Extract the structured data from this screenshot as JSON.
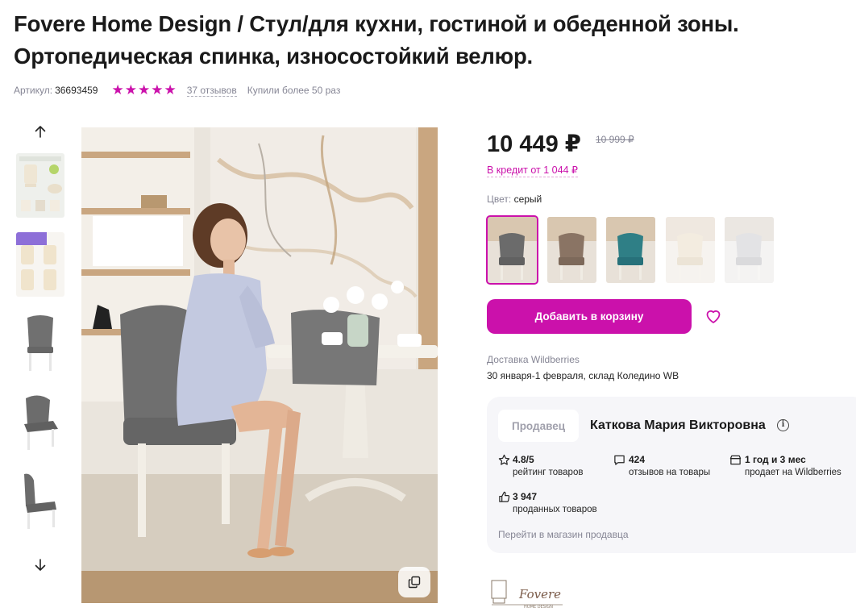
{
  "product": {
    "title": "Fovere Home Design / Стул/для кухни, гостиной и обеденной зоны. Ортопедическая спинка, износостойкий велюр.",
    "article_label": "Артикул:",
    "article_value": "36693459",
    "rating_stars": 5,
    "reviews_link": "37 отзывов",
    "bought": "Купили более 50 раз"
  },
  "gallery": {
    "up_icon": "arrow-up-icon",
    "down_icon": "arrow-down-icon",
    "zoom_icon": "copy-icon"
  },
  "price": {
    "current": "10 449 ₽",
    "old": "10 999 ₽",
    "credit": "В кредит от 1 044 ₽"
  },
  "color": {
    "label": "Цвет:",
    "value": "серый"
  },
  "actions": {
    "add_to_cart": "Добавить в корзину",
    "favorite_icon": "heart-icon"
  },
  "delivery": {
    "label": "Доставка Wildberries",
    "value": "30 января-1 февраля, склад Коледино WB"
  },
  "seller": {
    "tag": "Продавец",
    "name": "Каткова Мария Викторовна",
    "stats": [
      {
        "icon": "star-outline-icon",
        "value": "4.8/5",
        "label": "рейтинг товаров"
      },
      {
        "icon": "message-icon",
        "value": "424",
        "label": "отзывов на товары"
      },
      {
        "icon": "store-icon",
        "value": "1 год и 3 мес",
        "label": "продает на Wildberries"
      },
      {
        "icon": "thumbs-up-icon",
        "value": "3 947",
        "label": "проданных товаров"
      }
    ],
    "shop_link": "Перейти в магазин продавца"
  },
  "brand": {
    "logo_text": "Fovere",
    "logo_subtext": "HOME DESIGN"
  },
  "colors": {
    "accent": "#cb11ab",
    "text": "#242424",
    "muted": "#868695",
    "card_bg": "#f6f6f9"
  }
}
